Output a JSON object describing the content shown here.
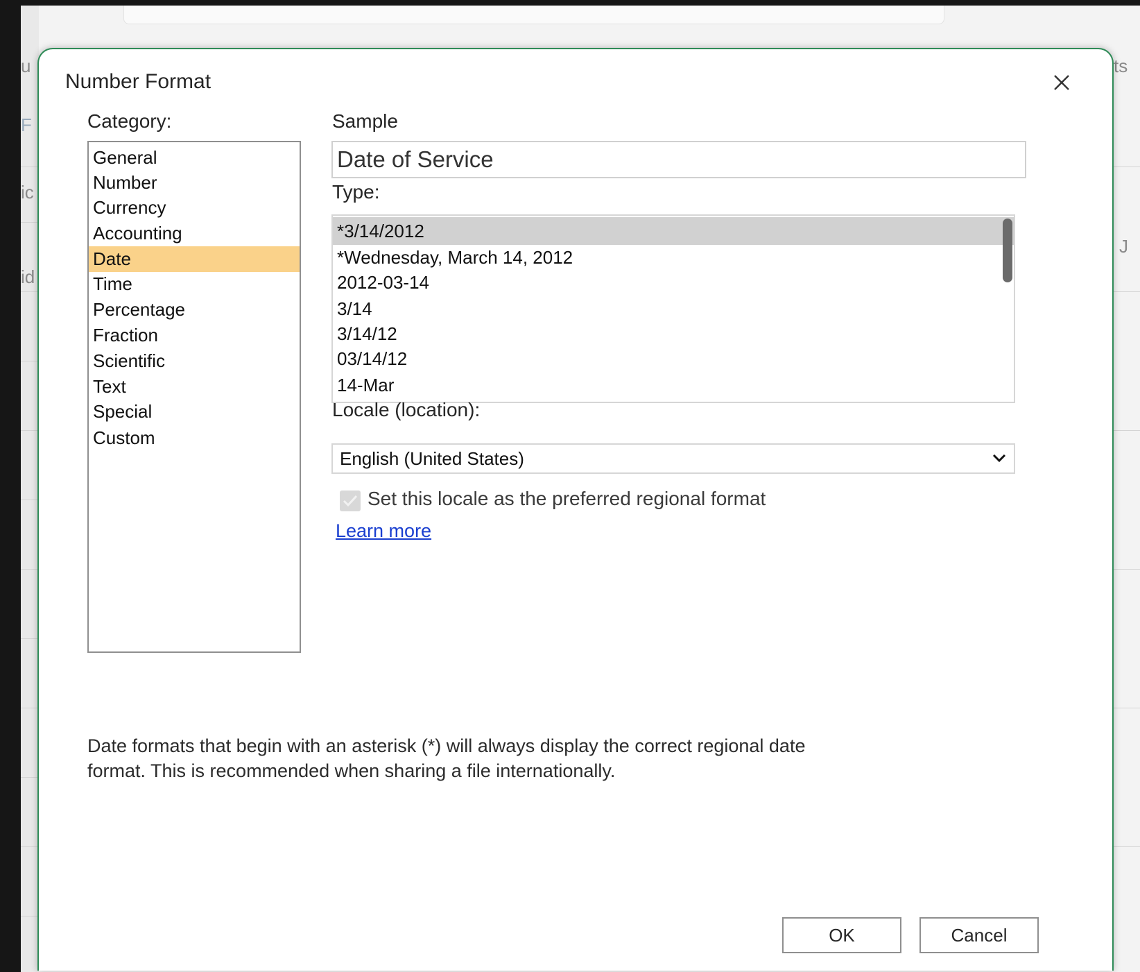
{
  "dialog": {
    "title": "Number Format",
    "category_label": "Category:",
    "sample_label": "Sample",
    "sample_value": "Date of Service",
    "type_label": "Type:",
    "locale_label": "Locale (location):",
    "locale_value": "English (United States)",
    "checkbox_label": "Set this locale as the preferred regional format",
    "checkbox_checked": true,
    "learn_more": "Learn more",
    "description_line1": "Date formats that begin with an asterisk (*) will always display the correct regional date",
    "description_line2": "format. This is recommended when sharing a file internationally.",
    "ok": "OK",
    "cancel": "Cancel"
  },
  "categories": [
    "General",
    "Number",
    "Currency",
    "Accounting",
    "Date",
    "Time",
    "Percentage",
    "Fraction",
    "Scientific",
    "Text",
    "Special",
    "Custom"
  ],
  "selected_category": "Date",
  "types": [
    "*3/14/2012",
    "*Wednesday, March 14, 2012",
    "2012-03-14",
    "3/14",
    "3/14/12",
    "03/14/12",
    "14-Mar"
  ],
  "selected_type": "*3/14/2012",
  "colors": {
    "category_selected": "#fad28a",
    "type_selected": "#d1d1d1",
    "dialog_border": "#2e8b57",
    "link": "#1a3fd0"
  },
  "background_fragments": [
    "u",
    "F",
    "ic",
    "id",
    "ts",
    "J"
  ],
  "icons": {
    "close": "close-icon",
    "dropdown": "chevron-down-icon",
    "check": "check-icon"
  }
}
